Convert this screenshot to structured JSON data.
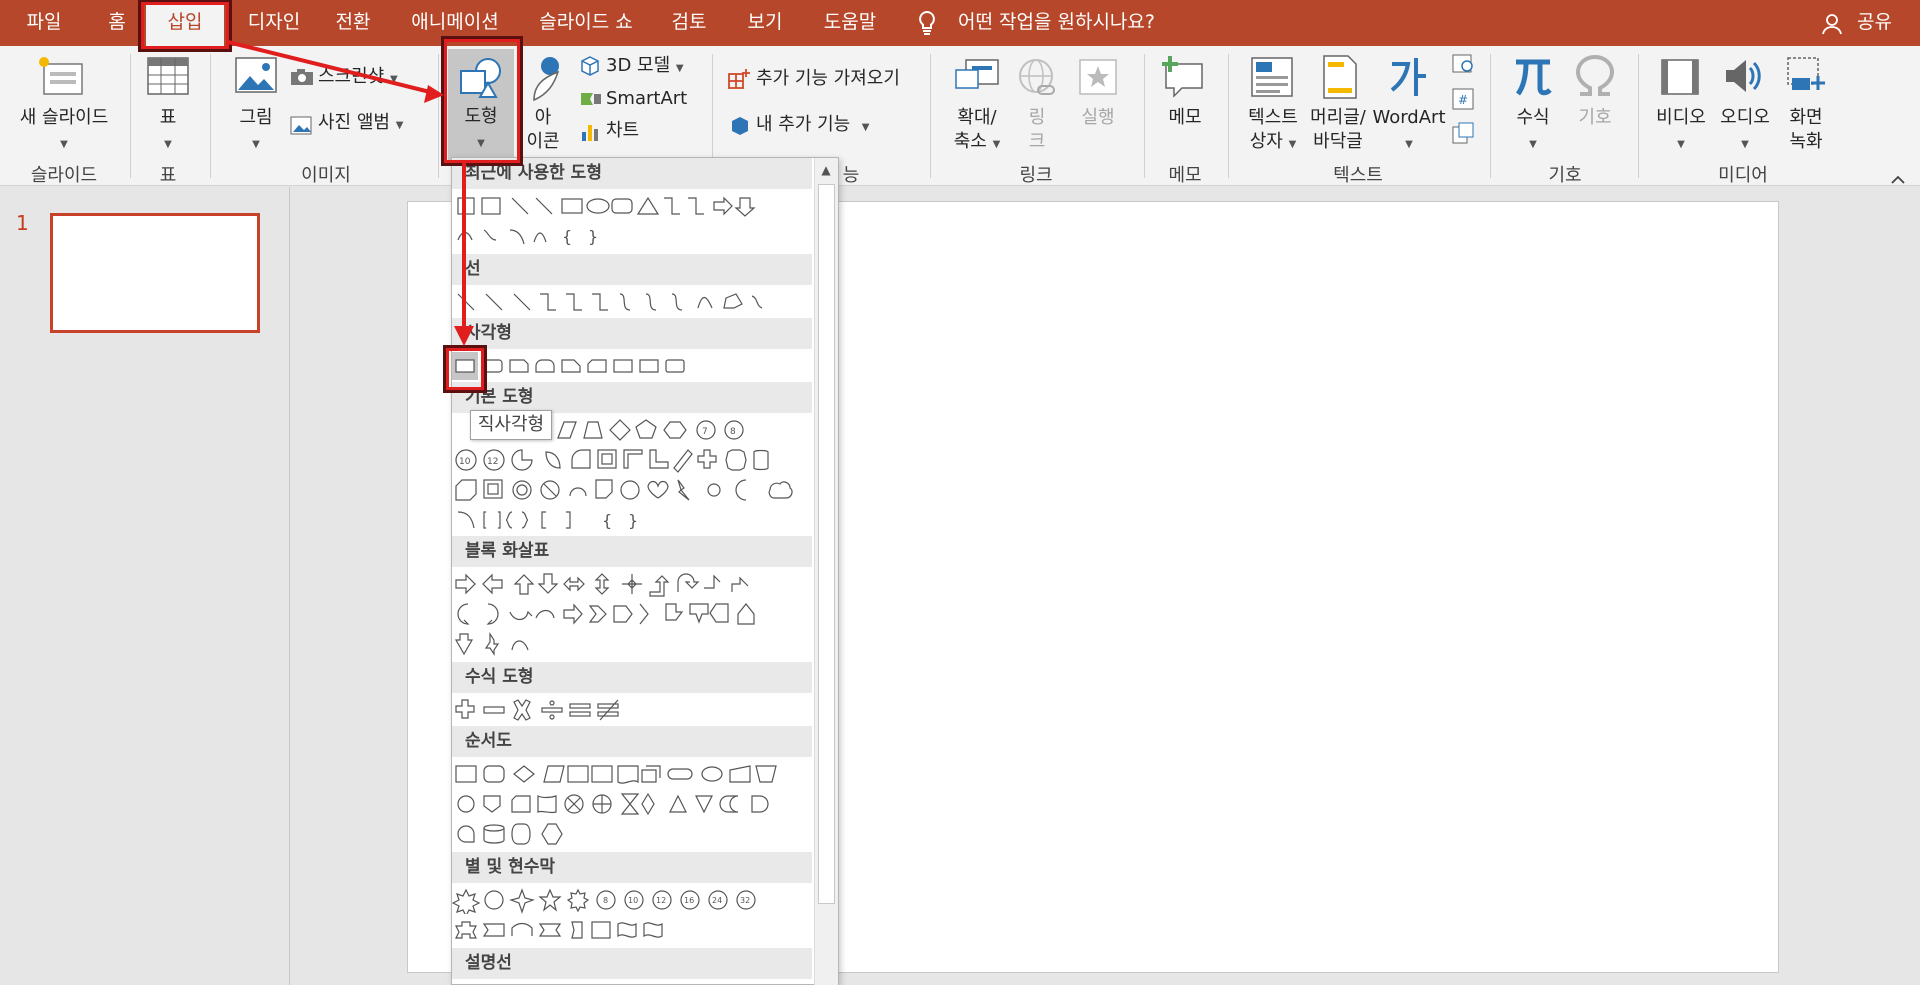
{
  "menu": {
    "tabs": [
      {
        "label": "파일"
      },
      {
        "label": "홈"
      },
      {
        "label": "삽입"
      },
      {
        "label": "디자인"
      },
      {
        "label": "전환"
      },
      {
        "label": "애니메이션"
      },
      {
        "label": "슬라이드 쇼"
      },
      {
        "label": "검토"
      },
      {
        "label": "보기"
      },
      {
        "label": "도움말"
      }
    ],
    "tell_me": "어떤 작업을 원하시나요?",
    "share": "공유"
  },
  "ribbon": {
    "new_slide": "새 슬라이드",
    "table": "표",
    "picture": "그림",
    "screenshot": "스크린샷",
    "photo_album": "사진 앨범",
    "shapes": "도형",
    "icons_line1": "아",
    "icons_line2": "이콘",
    "model3d": "3D 모델",
    "smartart": "SmartArt",
    "chart": "차트",
    "get_addins": "추가 기능 가져오기",
    "my_addins": "내 추가 기능",
    "zoom_line1": "확대/",
    "zoom_line2": "축소",
    "link_line1": "링",
    "link_line2": "크",
    "action": "실행",
    "comment": "메모",
    "textbox_line1": "텍스트",
    "textbox_line2": "상자",
    "header_line1": "머리글/",
    "header_line2": "바닥글",
    "wordart": "WordArt",
    "equation": "수식",
    "symbol": "기호",
    "video": "비디오",
    "audio": "오디오",
    "screenrec_line1": "화면",
    "screenrec_line2": "녹화",
    "groups": {
      "slides": "슬라이드",
      "tables": "표",
      "images": "이미지",
      "addins": "능",
      "links": "링크",
      "comments": "메모",
      "text": "텍스트",
      "symbols": "기호",
      "media": "미디어"
    }
  },
  "slides_panel": {
    "number": "1"
  },
  "gallery": {
    "sections": {
      "recent": "최근에 사용한 도형",
      "lines": "선",
      "rectangles": "사각형",
      "basic": "기본 도형",
      "block_arrows": "블록 화살표",
      "equation": "수식 도형",
      "flowchart": "순서도",
      "stars": "별 및 현수막",
      "callouts": "설명선"
    },
    "tooltip": "직사각형"
  },
  "colors": {
    "accent": "#b7472a",
    "highlight": "#e01e1e"
  }
}
